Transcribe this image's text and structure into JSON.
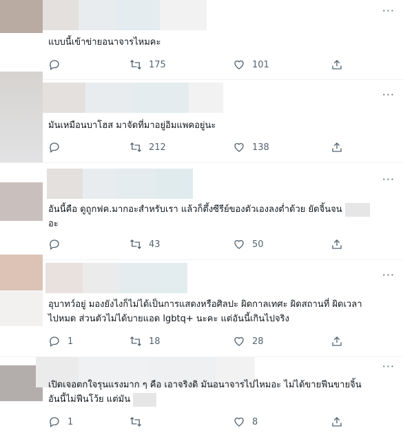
{
  "tweets": [
    {
      "text": "แบบนี้เข้าข่ายอนาจารไหมคะ",
      "text2": "",
      "reply": "",
      "retweet": "175",
      "like": "101"
    },
    {
      "text": "มันเหมือนบาโฮส  มาจัดที่มาอยู่อิมแพคอยู่นะ",
      "text2": "",
      "reply": "",
      "retweet": "212",
      "like": "138"
    },
    {
      "text": "อันนี้คือ ดูถูกฟค.มากอะสำหรับเรา แล้วก็ตึ้งซีรีย์ของตัวเองลงต่ำด้วย ยัดจิ้นจน",
      "text2": "อะ",
      "reply": "",
      "retweet": "43",
      "like": "50"
    },
    {
      "text": "อุบาทว์อยู่ มองยังไงก็ไม่ได้เป็นการแสดงหรือศิลปะ ผิดกาลเทศะ ผิดสถานที่ ผิดเวลา",
      "text2": "ไปหมด ส่วนตัวไม่ได้บายแอด lgbtq+ นะคะ แต่อันนี้เกินไปจริง",
      "reply": "1",
      "retweet": "18",
      "like": "28"
    },
    {
      "text": "เปิดเจอตกใจรุนแรงมาก ๆ คือ เอาจริงดิ มันอนาจารไปไหมอะ ไม่ได้ขายฟีนขายจิ้น",
      "text2": "อันนี้ไม่ฟีนโว้ย แต่มัน",
      "reply": "1",
      "retweet": "",
      "like": "8"
    }
  ],
  "more_label": "···"
}
